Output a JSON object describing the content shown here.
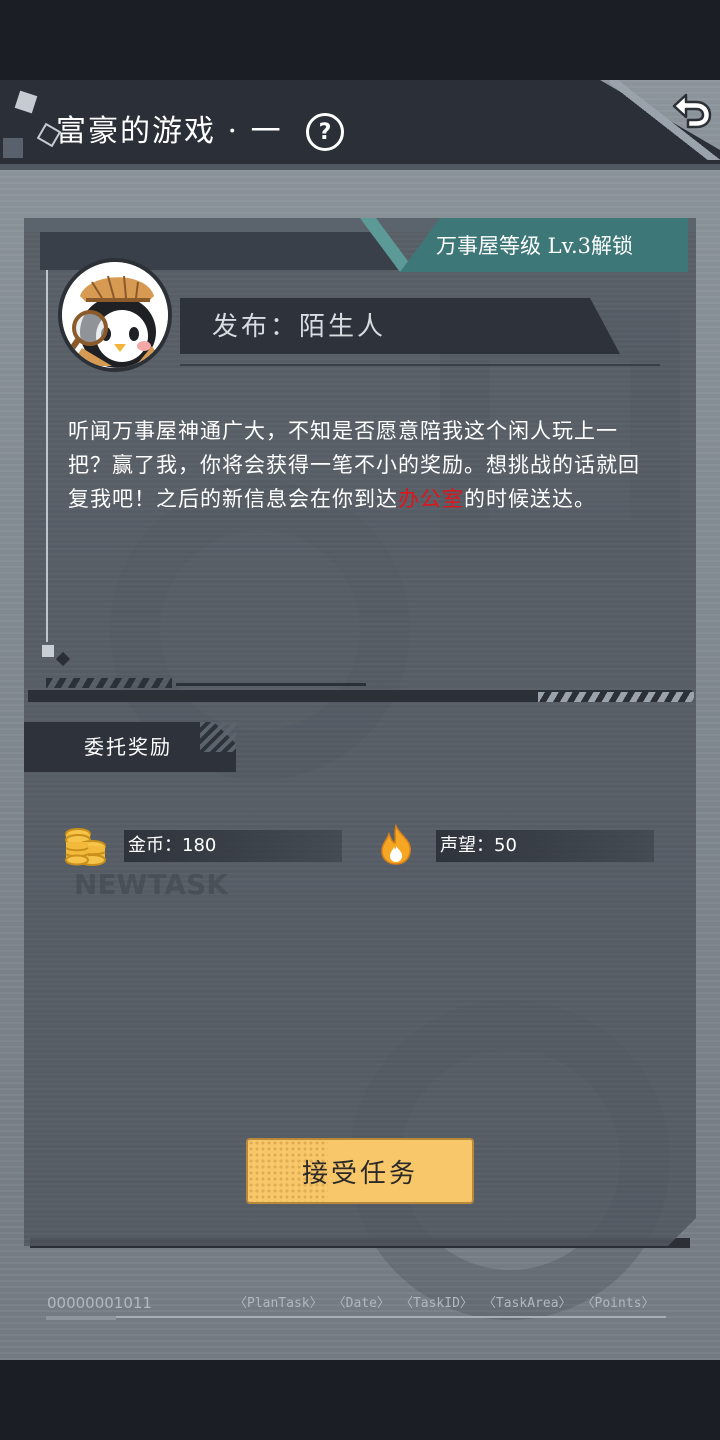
{
  "header": {
    "title": "富豪的游戏 · 一",
    "help_symbol": "?",
    "back_icon": "return-arrow-icon"
  },
  "task": {
    "unlock_requirement": "万事屋等级 Lv.3解锁",
    "publisher": "发布：陌生人",
    "description_before": "听闻万事屋神通广大，不知是否愿意陪我这个闲人玩上一把？赢了我，你将会获得一笔不小的奖励。想挑战的话就回复我吧！之后的新信息会在你到达",
    "description_highlight": "办公室",
    "description_after": "的时候送达。",
    "highlight_color": "#e0141b"
  },
  "rewards": {
    "header": "委托奖励",
    "items": [
      {
        "icon": "gold-coins-icon",
        "label": "金币：180"
      },
      {
        "icon": "fire-icon",
        "label": "声望：50"
      }
    ]
  },
  "watermark": "NEWTASK",
  "actions": {
    "accept_label": "接受任务",
    "accept_color": "#f7c76a"
  },
  "footer": {
    "id": "00000001011",
    "tags": [
      "〈PlanTask〉",
      "〈Date〉",
      "〈TaskID〉",
      "〈TaskArea〉",
      "〈Points〉"
    ]
  }
}
